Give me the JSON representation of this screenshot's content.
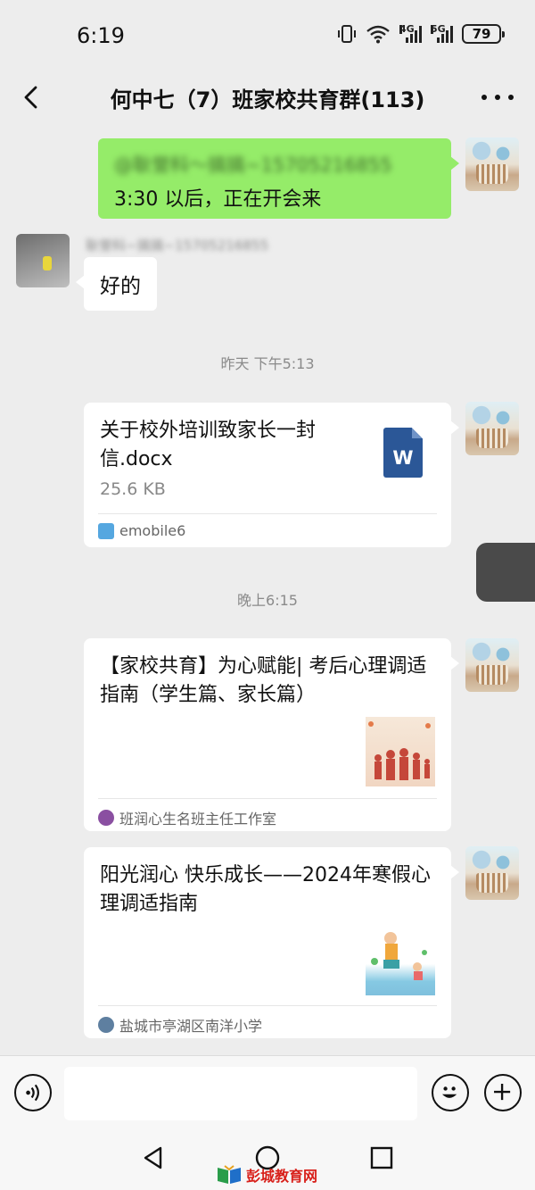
{
  "status_bar": {
    "time": "6:19",
    "network_1": "4G",
    "network_2": "5G",
    "battery": "79"
  },
  "header": {
    "title": "何中七（7）班家校共育群(113)"
  },
  "messages": {
    "self_mention": "@耿誉科～搞搞~15705216855",
    "self_text": "3:30 以后，正在开会来",
    "other_sender": "耿誉科~搞搞~15705216855",
    "other_text": "好的",
    "timestamp_1": "昨天 下午5:13",
    "file_title": "关于校外培训致家长一封信.docx",
    "file_size": "25.6 KB",
    "file_source": "emobile6",
    "file_icon_letter": "W",
    "timestamp_2": "晚上6:15",
    "article1_title": "【家校共育】为心赋能| 考后心理调适指南（学生篇、家长篇）",
    "article1_source": "班润心生名班主任工作室",
    "article2_title": "阳光润心 快乐成长——2024年寒假心理调适指南",
    "article2_source": "盐城市亭湖区南洋小学"
  },
  "input_bar": {
    "placeholder": ""
  },
  "watermark": {
    "text": "彭城教育网"
  },
  "colors": {
    "self_bubble": "#95ec69",
    "background": "#ededed",
    "word_blue": "#2b5797",
    "watermark_red": "#d8201a"
  }
}
